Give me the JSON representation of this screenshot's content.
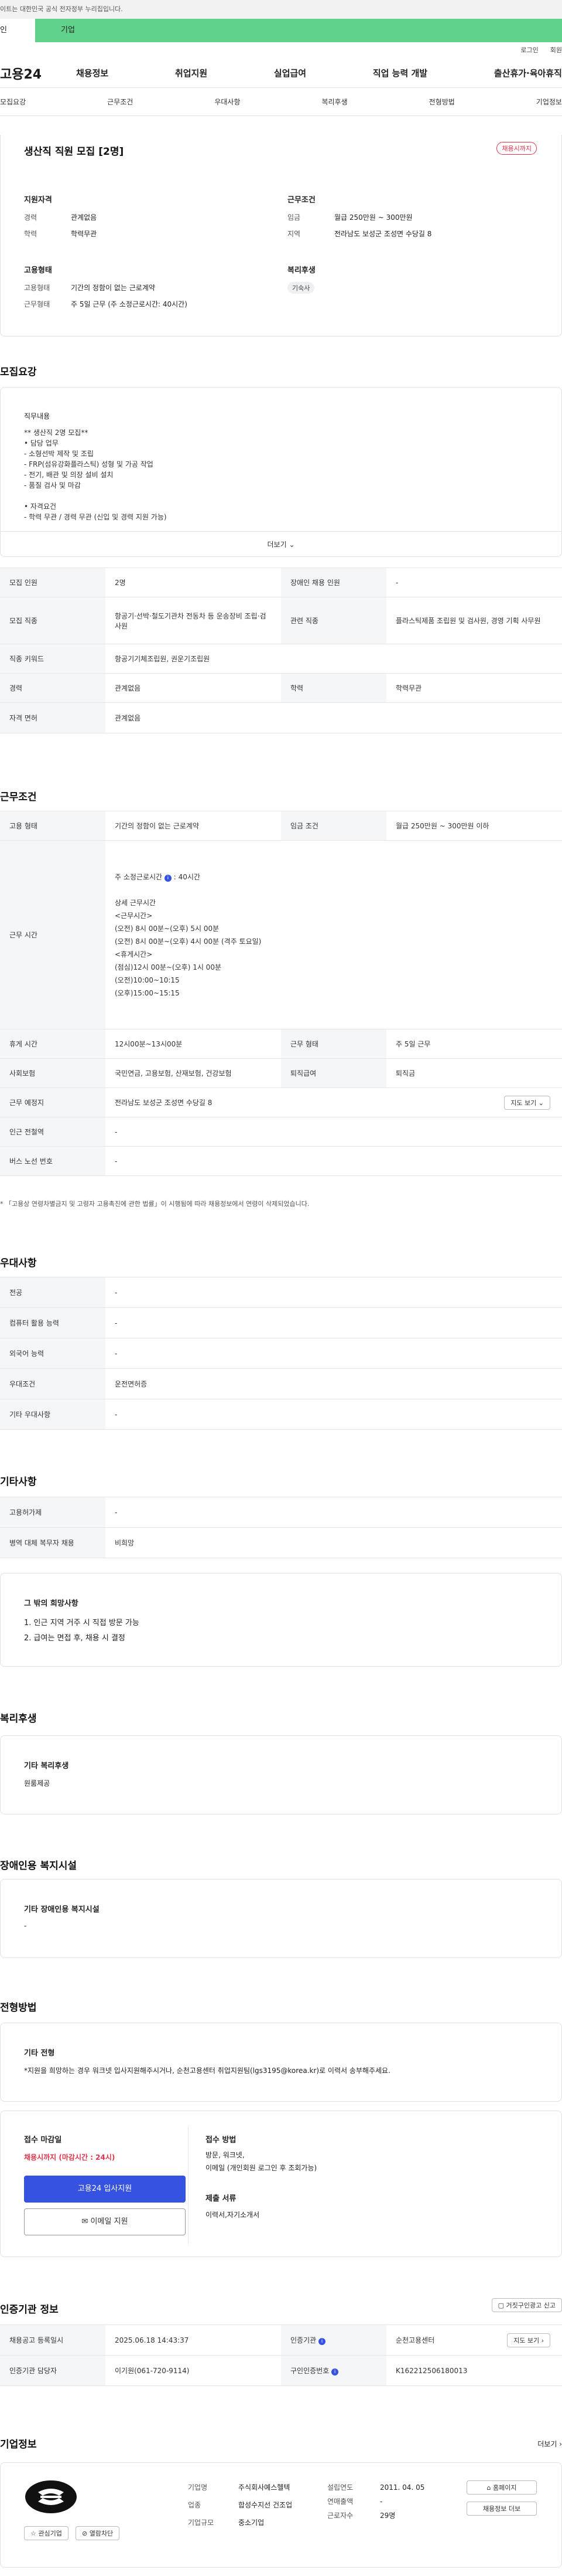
{
  "gov_notice": "이트는 대한민국 공식 전자정부 누리집입니다.",
  "tabs": {
    "personal": "인",
    "company": "기업"
  },
  "util": {
    "login": "로그인",
    "signup": "회원"
  },
  "logo": "고용24",
  "gnb": [
    "채용정보",
    "취업지원",
    "실업급여",
    "직업 능력 개발",
    "출산휴가·육아휴직"
  ],
  "subnav": [
    "모집요강",
    "근무조건",
    "우대사항",
    "복리후생",
    "전형방법",
    "기업정보"
  ],
  "header": {
    "title": "생산직 직원 모집 [2명]",
    "badge": "채용시까지",
    "qual": {
      "title": "지원자격",
      "career_label": "경력",
      "career": "관계없음",
      "edu_label": "학력",
      "edu": "학력무관"
    },
    "cond": {
      "title": "근무조건",
      "wage_label": "임금",
      "wage": "월급 250만원 ~ 300만원",
      "region_label": "지역",
      "region": "전라남도 보성군 조성면 수당길 8"
    },
    "emp": {
      "title": "고용형태",
      "type_label": "고용형태",
      "type": "기간의 정함이 없는 근로계약",
      "hours_label": "근무형태",
      "hours": "주 5일 근무 (주 소정근로시간: 40시간)"
    },
    "welfare": {
      "title": "복리후생",
      "tag": "기숙사"
    }
  },
  "recruit": {
    "title": "모집요강",
    "job_title": "직무내용",
    "lines": [
      "** 생산직 2명 모집**",
      "• 담당 업무",
      "- 소형선박 제작 및 조립",
      "- FRP(섬유강화플라스틱) 성형 및 가공 작업",
      "- 전기, 배관 및 의장 설비 설치",
      "- 품질 검사 및 마감",
      "",
      "• 자격요건",
      "- 학력 무관 / 경력 무관 (신입 및 경력 지원 가능)"
    ],
    "more": "더보기",
    "table": {
      "count_label": "모집 인원",
      "count": "2명",
      "disabled_label": "장애인 채용 인원",
      "disabled": "-",
      "job_label": "모집 직종",
      "job": "항공기·선박·철도기관차 전동차 등 운송장비 조립·검사원",
      "rel_label": "관련 직종",
      "rel": "플라스틱제품 조립원 및 검사원, 경영 기획 사무원",
      "kw_label": "직종 키워드",
      "kw": "항공기기체조립원, 권운기조립원",
      "career_label": "경력",
      "career": "관계없음",
      "edu_label": "학력",
      "edu": "학력무관",
      "lic_label": "자격 면허",
      "lic": "관계없음"
    }
  },
  "work": {
    "title": "근무조건",
    "emp_label": "고용 형태",
    "emp": "기간의 정함이 없는 근로계약",
    "wage_label": "임금 조건",
    "wage": "월급 250만원 ~ 300만원 이하",
    "time_label": "근무 시간",
    "time_head": "주 소정근로시간",
    "time_hours": "40시간",
    "time_lines": [
      "상세 근무시간",
      "<근무시간>",
      "(오전) 8시 00분~(오후) 5시 00분",
      "(오전) 8시 00분~(오후) 4시 00분 (격주 토요일)",
      "<휴게시간>",
      "(점심)12시 00분~(오후) 1시 00분",
      "(오전)10:00~10:15",
      "(오후)15:00~15:15"
    ],
    "break_label": "휴게 시간",
    "break": "12시00분~13시00분",
    "type_label": "근무 형태",
    "type": "주 5일 근무",
    "ins_label": "사회보험",
    "ins": "국민연금, 고용보험, 산재보험, 건강보험",
    "ret_label": "퇴직급여",
    "ret": "퇴직금",
    "place_label": "근무 예정지",
    "place": "전라남도 보성군 조성면 수당길 8",
    "map": "지도 보기",
    "subway_label": "인근 전철역",
    "subway": "-",
    "bus_label": "버스 노선 번호",
    "bus": "-",
    "note": "* 「고용상 연령차별금지 및 고령자 고용촉진에 관한 법률」이 시행됨에 따라 채용정보에서 연령이 삭제되었습니다."
  },
  "pref": {
    "title": "우대사항",
    "major_label": "전공",
    "major": "-",
    "pc_label": "컴퓨터 활용 능력",
    "pc": "-",
    "lang_label": "외국어 능력",
    "lang": "-",
    "cond_label": "우대조건",
    "cond": "운전면허증",
    "etc_label": "기타 우대사항",
    "etc": "-"
  },
  "other": {
    "title": "기타사항",
    "foreign_label": "고용허가제",
    "foreign": "-",
    "mil_label": "병역 대체 복무자 채용",
    "mil": "비희망",
    "hope_title": "그 밖의 희망사항",
    "hope": [
      "1. 인근 지역 거주 시 직접 방문 가능",
      "2. 급여는 면접 후, 채용 시 결정"
    ]
  },
  "benefit": {
    "title": "복리후생",
    "card_title": "기타 복리후생",
    "card_val": "원룸제공"
  },
  "facility": {
    "title": "장애인용 복지시설",
    "card_title": "기타 장애인용 복지시설",
    "card_val": "-"
  },
  "process": {
    "title": "전형방법",
    "card_title": "기타 전형",
    "card_val": "*지원을 희망하는 경우 워크넷 입사지원해주시거나, 순천고용센터 취업지원팀(lgs3195@korea.kr)로 이력서 송부해주세요.",
    "deadline_label": "접수 마감일",
    "deadline": "채용시까지 (마감시간 : 24시)",
    "apply_btn": "고용24 입사지원",
    "email_btn": "이메일 지원",
    "method_label": "접수 방법",
    "method": "방문, 워크넷,",
    "method2": "이메일 (개인회원 로그인 후 조회가능)",
    "docs_label": "제출 서류",
    "docs": "이력서,자기소개서"
  },
  "agency": {
    "title": "인증기관 정보",
    "report": "거짓구인광고 신고",
    "reg_label": "채용공고 등록일시",
    "reg": "2025.06.18 14:43:37",
    "org_label": "인증기관",
    "org": "순천고용센터",
    "map": "지도 보기",
    "mgr_label": "인증기관 담당자",
    "mgr": "이기원(061-720-9114)",
    "no_label": "구인인증번호",
    "no": "K162212506180013"
  },
  "company": {
    "title": "기업정보",
    "more": "더보기",
    "name_label": "기업명",
    "name": "주식회사예스헬텍",
    "ind_label": "업종",
    "ind": "합성수지선 건조업",
    "size_label": "기업규모",
    "size": "중소기업",
    "year_label": "설립연도",
    "year": "2011. 04. 05",
    "sales_label": "연매출액",
    "sales": "-",
    "emp_label": "근로자수",
    "emp": "29명",
    "home": "홈페이지",
    "other_jobs": "채용정보 더보",
    "fav": "관심기업",
    "block": "열람차단"
  },
  "colors": {
    "accent": "#3553e0",
    "green": "#60d28b",
    "red": "#e0334a"
  }
}
